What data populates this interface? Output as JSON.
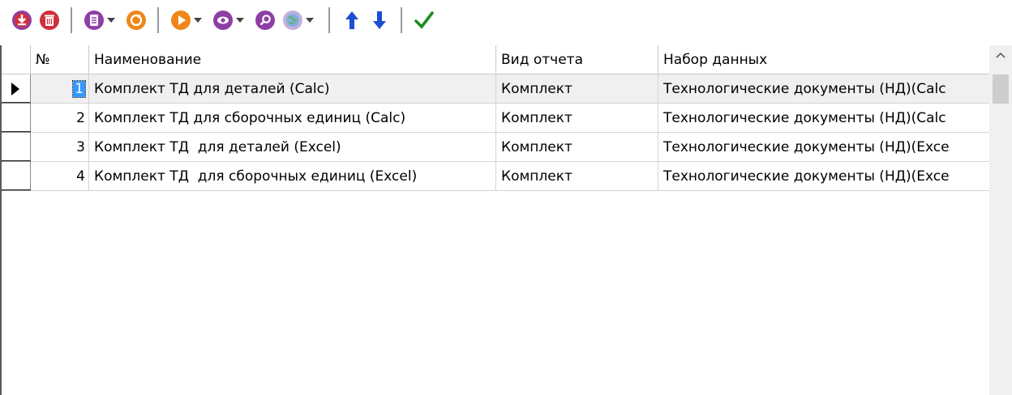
{
  "toolbar": {
    "buttons": [
      {
        "icon": "download-icon",
        "color": "#d0303a"
      },
      {
        "icon": "trash-icon",
        "color": "#d0303a"
      },
      {
        "icon": "document-list-icon",
        "color": "#8e3fa6"
      },
      {
        "icon": "refresh-icon",
        "color": "#f0861a"
      },
      {
        "icon": "play-icon",
        "color": "#f0861a"
      },
      {
        "icon": "eye-icon",
        "color": "#8e3fa6"
      },
      {
        "icon": "search-icon",
        "color": "#8e3fa6"
      },
      {
        "icon": "globe-icon",
        "color": "#a78cc8"
      },
      {
        "icon": "arrow-up-icon",
        "color": "#1a4fd0"
      },
      {
        "icon": "arrow-down-icon",
        "color": "#1a4fd0"
      },
      {
        "icon": "checkmark-icon",
        "color": "#1e8c1e"
      }
    ]
  },
  "grid": {
    "columns": [
      "№",
      "Наименование",
      "Вид отчета",
      "Набор данных"
    ],
    "rows": [
      {
        "num": "1",
        "name": "Комплект ТД для деталей (Calc)",
        "type": "Комплект",
        "dataset": "Технологические документы (НД)(Calc"
      },
      {
        "num": "2",
        "name": "Комплект ТД для сборочных единиц (Calc)",
        "type": "Комплект",
        "dataset": "Технологические документы (НД)(Calc"
      },
      {
        "num": "3",
        "name": "Комплект ТД  для деталей (Excel)",
        "type": "Комплект",
        "dataset": "Технологические документы (НД)(Exce"
      },
      {
        "num": "4",
        "name": "Комплект ТД  для сборочных единиц (Excel)",
        "type": "Комплект",
        "dataset": "Технологические документы (НД)(Exce"
      }
    ],
    "selected_row": 1
  },
  "colors": {
    "selection": "#3399ff",
    "row_selected_bg": "#f0f0f0",
    "grid_line": "#d4d4d4"
  }
}
